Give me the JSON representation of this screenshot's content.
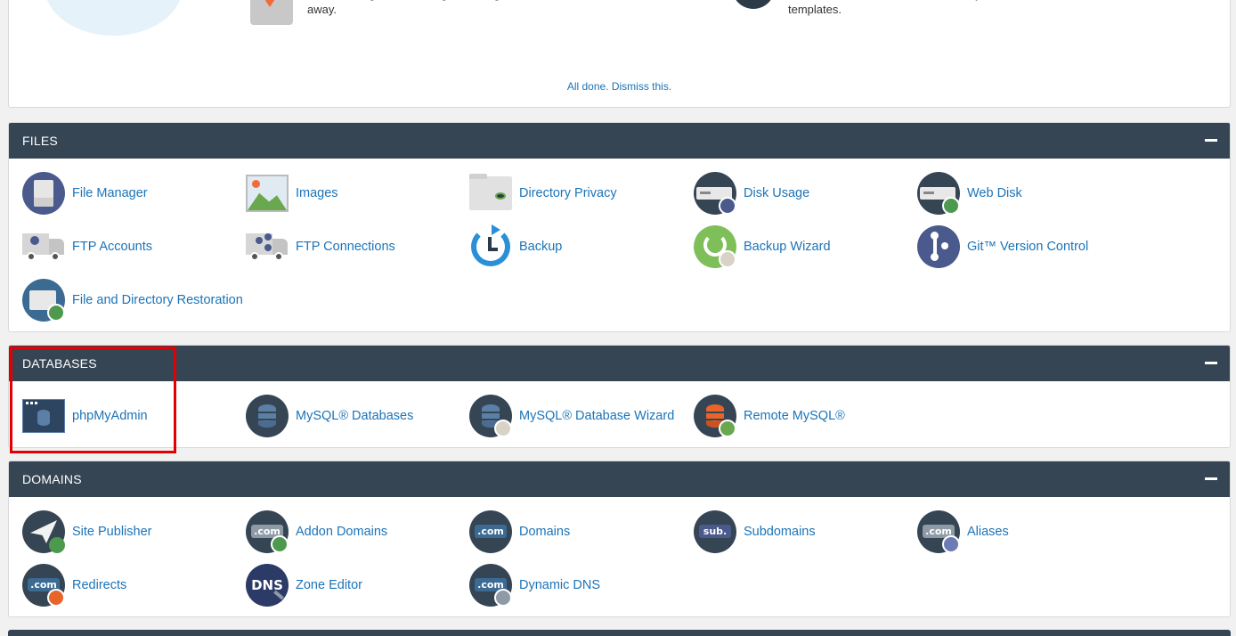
{
  "promo": {
    "email_text": "Start sending and receiving emails right away.",
    "site_text": "Build a new website with user-friendly templates.",
    "dismiss": "All done. Dismiss this."
  },
  "sections": {
    "files": {
      "title": "FILES",
      "items": [
        {
          "label": "File Manager",
          "icon": "file-manager-icon"
        },
        {
          "label": "Images",
          "icon": "images-icon"
        },
        {
          "label": "Directory Privacy",
          "icon": "directory-privacy-icon"
        },
        {
          "label": "Disk Usage",
          "icon": "disk-usage-icon"
        },
        {
          "label": "Web Disk",
          "icon": "web-disk-icon"
        },
        {
          "label": "FTP Accounts",
          "icon": "ftp-accounts-icon"
        },
        {
          "label": "FTP Connections",
          "icon": "ftp-connections-icon"
        },
        {
          "label": "Backup",
          "icon": "backup-icon"
        },
        {
          "label": "Backup Wizard",
          "icon": "backup-wizard-icon"
        },
        {
          "label": "Git™ Version Control",
          "icon": "git-icon"
        },
        {
          "label": "File and Directory Restoration",
          "icon": "restoration-icon"
        }
      ]
    },
    "databases": {
      "title": "DATABASES",
      "items": [
        {
          "label": "phpMyAdmin",
          "icon": "phpmyadmin-icon"
        },
        {
          "label": "MySQL® Databases",
          "icon": "mysql-databases-icon"
        },
        {
          "label": "MySQL® Database Wizard",
          "icon": "mysql-wizard-icon"
        },
        {
          "label": "Remote MySQL®",
          "icon": "remote-mysql-icon"
        }
      ]
    },
    "domains": {
      "title": "DOMAINS",
      "items": [
        {
          "label": "Site Publisher",
          "icon": "site-publisher-icon"
        },
        {
          "label": "Addon Domains",
          "icon": "addon-domains-icon"
        },
        {
          "label": "Domains",
          "icon": "domains-icon"
        },
        {
          "label": "Subdomains",
          "icon": "subdomains-icon"
        },
        {
          "label": "Aliases",
          "icon": "aliases-icon"
        },
        {
          "label": "Redirects",
          "icon": "redirects-icon"
        },
        {
          "label": "Zone Editor",
          "icon": "zone-editor-icon"
        },
        {
          "label": "Dynamic DNS",
          "icon": "dynamic-dns-icon"
        }
      ]
    }
  },
  "badges": {
    "com": ".com",
    "sub": "sub.",
    "dns": "DNS"
  },
  "colors": {
    "header": "#364554",
    "link": "#1b74b8",
    "highlight": "#e30000"
  }
}
